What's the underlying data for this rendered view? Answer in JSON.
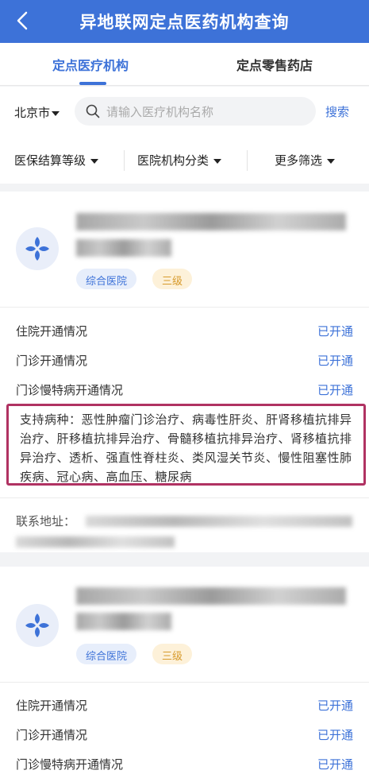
{
  "header": {
    "title": "异地联网定点医药机构查询",
    "back_icon": "chevron-left-icon"
  },
  "tabs": [
    {
      "label": "定点医疗机构",
      "active": true
    },
    {
      "label": "定点零售药店",
      "active": false
    }
  ],
  "search": {
    "city": "北京市",
    "placeholder": "请输入医疗机构名称",
    "button": "搜索"
  },
  "filters": [
    {
      "label": "医保结算等级"
    },
    {
      "label": "医院机构分类"
    },
    {
      "label": "更多筛选"
    }
  ],
  "colors": {
    "accent": "#3d72d8",
    "highlight_border": "#b03262",
    "level_tag_text": "#d79a2b"
  },
  "cards": [
    {
      "tags": {
        "type": "综合医院",
        "level": "三级"
      },
      "rows": [
        {
          "label": "住院开通情况",
          "value": "已开通"
        },
        {
          "label": "门诊开通情况",
          "value": "已开通"
        },
        {
          "label": "门诊慢特病开通情况",
          "value": "已开通"
        }
      ],
      "diseases": "支持病种：恶性肿瘤门诊治疗、病毒性肝炎、肝肾移植抗排异治疗、肝移植抗排异治疗、骨髓移植抗排异治疗、肾移植抗排异治疗、透析、强直性脊柱炎、类风湿关节炎、慢性阻塞性肺疾病、冠心病、高血压、糖尿病",
      "address_label": "联系地址："
    },
    {
      "tags": {
        "type": "综合医院",
        "level": "三级"
      },
      "rows": [
        {
          "label": "住院开通情况",
          "value": "已开通"
        },
        {
          "label": "门诊开通情况",
          "value": "已开通"
        },
        {
          "label": "门诊慢特病开通情况",
          "value": "已开通"
        }
      ]
    }
  ]
}
